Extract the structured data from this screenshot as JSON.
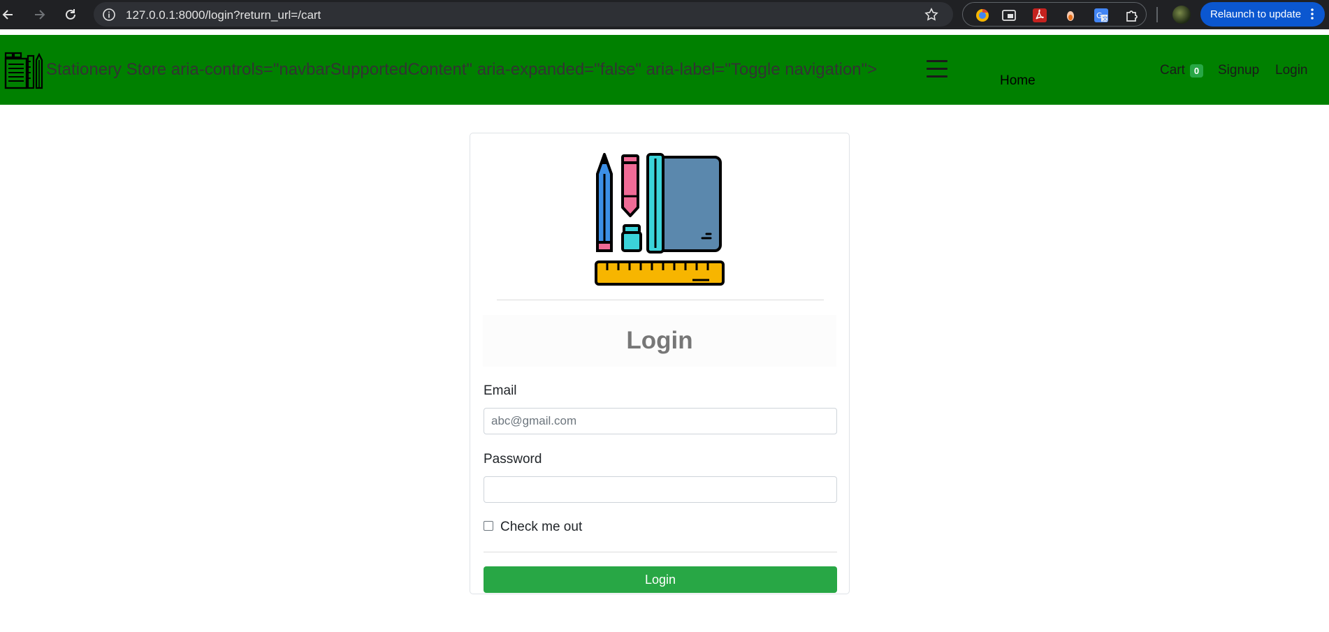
{
  "browser": {
    "url": "127.0.0.1:8000/login?return_url=/cart",
    "relaunch_label": "Relaunch to update"
  },
  "navbar": {
    "brand": "Stationery Store aria-controls=\"navbarSupportedContent\" aria-expanded=\"false\" aria-label=\"Toggle navigation\">",
    "home": "Home",
    "cart": "Cart",
    "cart_count": "0",
    "signup": "Signup",
    "login": "Login",
    "bg_color": "#008000"
  },
  "form": {
    "title": "Login",
    "email_label": "Email",
    "email_placeholder": "abc@gmail.com",
    "email_value": "",
    "password_label": "Password",
    "password_value": "",
    "check_label": "Check me out",
    "submit_label": "Login",
    "accent_color": "#28a745"
  }
}
